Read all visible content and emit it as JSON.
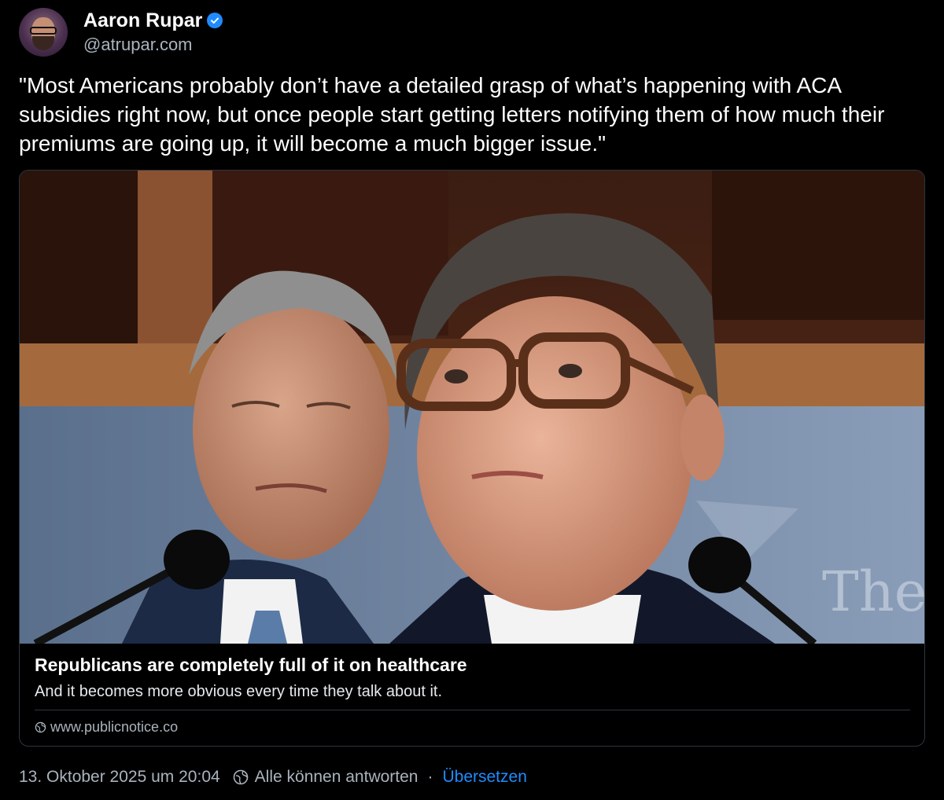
{
  "author": {
    "display_name": "Aaron Rupar",
    "handle": "@atrupar.com",
    "verified": true
  },
  "post": {
    "text": "\"Most Americans probably don’t have a detailed grasp of what’s happening with ACA subsidies right now, but once people start getting letters notifying them of how much their premiums are going up, it will become a much bigger issue.\""
  },
  "link_card": {
    "title": "Republicans are completely full of it on healthcare",
    "description": "And it becomes more obvious every time they talk about it.",
    "domain": "www.publicnotice.co",
    "image_watermark": "The"
  },
  "footer": {
    "timestamp": "13. Oktober 2025 um 20:04",
    "reply_setting": "Alle können antworten",
    "separator": "·",
    "translate_label": "Übersetzen"
  },
  "colors": {
    "background": "#000000",
    "accent": "#208bfe",
    "muted_text": "#aab3bd",
    "border": "#2c3640"
  },
  "icons": {
    "verified": "verified-check-icon",
    "domain": "globe-icon",
    "reply_setting": "globe-reply-icon"
  }
}
